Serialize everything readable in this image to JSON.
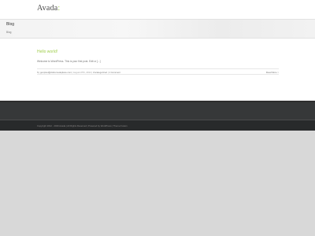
{
  "header": {
    "logo_main": "Avada",
    "logo_accent": ":"
  },
  "titlebar": {
    "title": "Blog",
    "breadcrumb": "Blog"
  },
  "post": {
    "title": "Hello world!",
    "excerpt": "Welcome to WordPress. This is your first post. Edit or [...]",
    "meta_prefix": "By",
    "author": "genpixel@dolzemedeplace.com",
    "separator": "|",
    "date": "August 27th, 2014",
    "category": "Uncategorized",
    "comments": "1 Comment",
    "read_more": "Read More >"
  },
  "footer": {
    "copyright": "Copyright 2012 - 2020 Avada | All Rights Reserved | Powered by WordPress | Theme Fusion"
  },
  "colors": {
    "accent": "#a0ce4e",
    "footer_bg": "#363839",
    "copyright_bg": "#282a2b"
  }
}
